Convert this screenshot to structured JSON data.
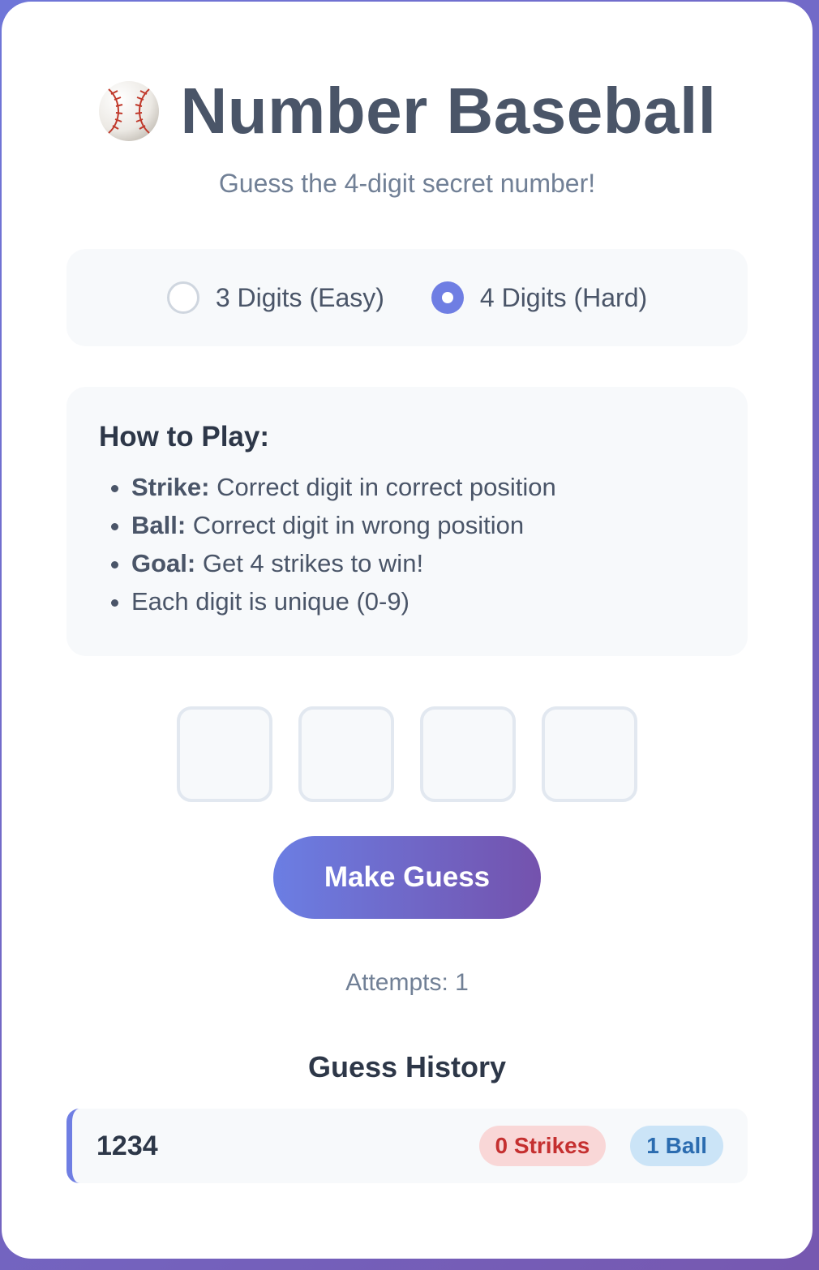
{
  "header": {
    "title": "Number Baseball",
    "icon": "baseball-icon",
    "subtitle": "Guess the 4-digit secret number!"
  },
  "mode": {
    "options": [
      {
        "label": "3 Digits (Easy)",
        "selected": false
      },
      {
        "label": "4 Digits (Hard)",
        "selected": true
      }
    ]
  },
  "howto": {
    "title": "How to Play:",
    "rules": [
      {
        "term": "Strike:",
        "text": " Correct digit in correct position"
      },
      {
        "term": "Ball:",
        "text": " Correct digit in wrong position"
      },
      {
        "term": "Goal:",
        "text": " Get 4 strikes to win!"
      },
      {
        "term": "",
        "text": "Each digit is unique (0-9)"
      }
    ]
  },
  "digits": {
    "values": [
      "",
      "",
      "",
      ""
    ]
  },
  "actions": {
    "guess_label": "Make Guess"
  },
  "status": {
    "attempts": "Attempts: 1"
  },
  "history": {
    "title": "Guess History",
    "entries": [
      {
        "guess": "1234",
        "strikes": "0 Strikes",
        "balls": "1 Ball"
      }
    ]
  },
  "colors": {
    "accent": "#6f7ee3",
    "gradient_start": "#6b7ee3",
    "gradient_end": "#7452ad",
    "strike_bg": "#f9d7d7",
    "strike_text": "#c53030",
    "ball_bg": "#cbe4f7",
    "ball_text": "#2b6cb0"
  }
}
